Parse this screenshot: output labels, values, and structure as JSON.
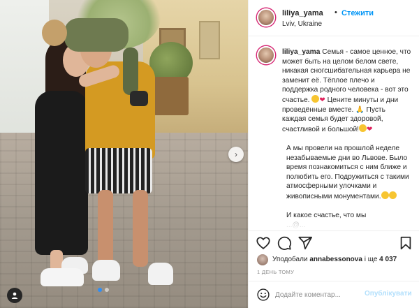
{
  "post": {
    "username": "liliya_yama",
    "separator": "•",
    "follow_label": "Стежити",
    "location": "Lviv, Ukraine"
  },
  "caption": {
    "username": "liliya_yama",
    "p1_text": "Семья - самое ценное, что может быть на целом белом свете, никакая сногсшибательная карьера не заменит её. Тёплое плечо и поддержка родного человека - вот это счастье.",
    "p1_text2": "Цените минуты и дни проведённые вместе.",
    "p1_text3": "Пусть каждая семья будет здоровой, счастливой и большой!",
    "p2_text": "А мы провели на прошлой неделе незабываемые дни во Львове. Было время познакомиться с ним ближе и полюбить его. Подружиться с такими атмосферными улочками и живописными монументами.",
    "p3_text": "И какое счастье, что мы",
    "p3_cut": "...@..."
  },
  "emojis": {
    "heart": "❤",
    "pray": "🙏"
  },
  "icons": {
    "like": "heart-outline-icon",
    "comment": "comment-bubble-icon",
    "share": "paper-plane-icon",
    "save": "bookmark-icon",
    "next": "chevron-right-icon",
    "tag": "user-tag-icon",
    "emoji": "smiley-icon"
  },
  "likes": {
    "prefix": "Уподобали",
    "user": "annabessonova",
    "suffix": "і ще",
    "count": "4 037"
  },
  "timestamp": "1 ДЕНЬ ТОМУ",
  "comment": {
    "placeholder": "Додайте коментар...",
    "post_label": "Опублікувати"
  },
  "carousel": {
    "next_glyph": "›",
    "total_slides": 2,
    "active_slide": 1
  },
  "colors": {
    "accent": "#0095f6",
    "post_disabled": "#b2dffc",
    "text": "#262626",
    "muted": "#8e8e8e"
  }
}
